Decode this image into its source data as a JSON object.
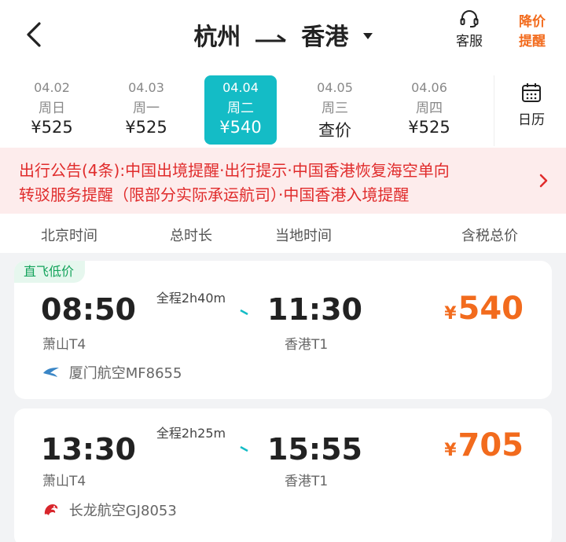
{
  "header": {
    "origin": "杭州",
    "destination": "香港",
    "customer_service": "客服",
    "price_alert_line1": "降价",
    "price_alert_line2": "提醒"
  },
  "dates": [
    {
      "date": "04.02",
      "weekday": "周日",
      "price": "¥525",
      "selected": false
    },
    {
      "date": "04.03",
      "weekday": "周一",
      "price": "¥525",
      "selected": false
    },
    {
      "date": "04.04",
      "weekday": "周二",
      "price": "¥540",
      "selected": true
    },
    {
      "date": "04.05",
      "weekday": "周三",
      "price": "查价",
      "selected": false
    },
    {
      "date": "04.06",
      "weekday": "周四",
      "price": "¥525",
      "selected": false
    }
  ],
  "calendar_label": "日历",
  "notice": {
    "line1": "出行公告(4条):中国出境提醒·出行提示·中国香港恢复海空单向",
    "line2": "转驳服务提醒（限部分实际承运航司）·中国香港入境提醒"
  },
  "columns": {
    "beijing_time": "北京时间",
    "duration": "总时长",
    "local_time": "当地时间",
    "total_price": "含税总价"
  },
  "flights": [
    {
      "badge": "直飞低价",
      "depart_time": "08:50",
      "arrive_time": "11:30",
      "duration": "全程2h40m",
      "depart_terminal": "萧山T4",
      "arrive_terminal": "香港T1",
      "airline": "厦门航空MF8655",
      "currency": "¥",
      "price": "540"
    },
    {
      "badge": "",
      "depart_time": "13:30",
      "arrive_time": "15:55",
      "duration": "全程2h25m",
      "depart_terminal": "萧山T4",
      "arrive_terminal": "香港T1",
      "airline": "长龙航空GJ8053",
      "currency": "¥",
      "price": "705"
    }
  ],
  "colors": {
    "accent": "#14bcc6",
    "notice_text": "#e02b2b",
    "notice_bg": "#fdecec",
    "price": "#f26b1d",
    "badge_text": "#13a35b"
  },
  "icons": {
    "back": "chevron-left-icon",
    "customer_service": "headset-icon",
    "calendar": "calendar-icon",
    "notice_more": "chevron-right-icon"
  }
}
